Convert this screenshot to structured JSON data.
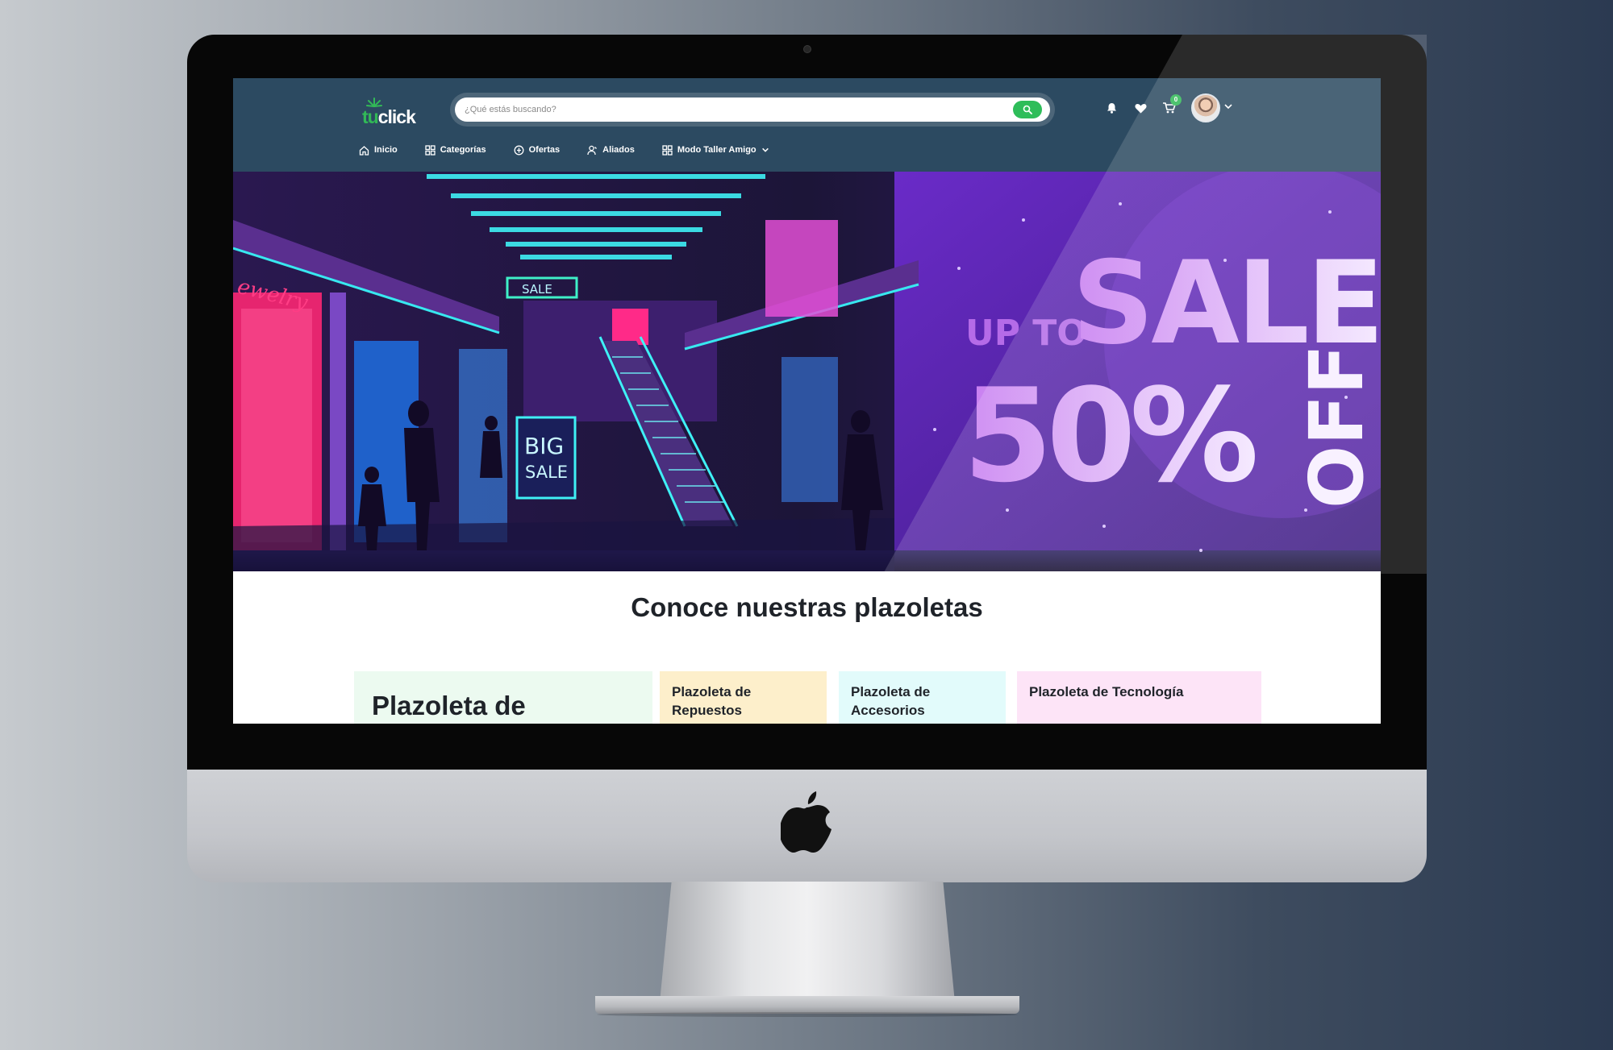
{
  "app": {
    "logo_prefix": "tu",
    "logo_suffix": "click"
  },
  "header": {
    "search": {
      "placeholder": "¿Qué estás buscando?"
    },
    "cart_count": "0",
    "nav": [
      {
        "label": "Inicio",
        "icon": "home-icon"
      },
      {
        "label": "Categorías",
        "icon": "grid-icon"
      },
      {
        "label": "Ofertas",
        "icon": "offer-icon"
      },
      {
        "label": "Aliados",
        "icon": "partner-icon"
      },
      {
        "label": "Modo Taller Amigo",
        "icon": "grid-icon"
      }
    ],
    "icons": [
      "bell-icon",
      "heart-icon",
      "cart-icon",
      "avatar",
      "chevron-down-icon"
    ]
  },
  "hero": {
    "prefix": "UP TO",
    "headline": "SALE",
    "percent": "50%",
    "suffix": "OFF",
    "sign_sale": "SALE",
    "sign_big": "BIG",
    "sign_big_sale": "SALE",
    "sign_jewelry": "ewelry"
  },
  "section": {
    "title": "Conoce nuestras plazoletas"
  },
  "cards": [
    {
      "label": "Plazoleta de"
    },
    {
      "label": "Plazoleta de Repuestos"
    },
    {
      "label": "Plazoleta de Accesorios"
    },
    {
      "label": "Plazoleta de Tecnología"
    }
  ],
  "colors": {
    "header_bg": "#2c4a61",
    "brand_green": "#32b957",
    "card_green": "#ecfaf0",
    "card_orange": "#fdefcb",
    "card_cyan": "#e2fbfb",
    "card_pink": "#fde4f7"
  }
}
